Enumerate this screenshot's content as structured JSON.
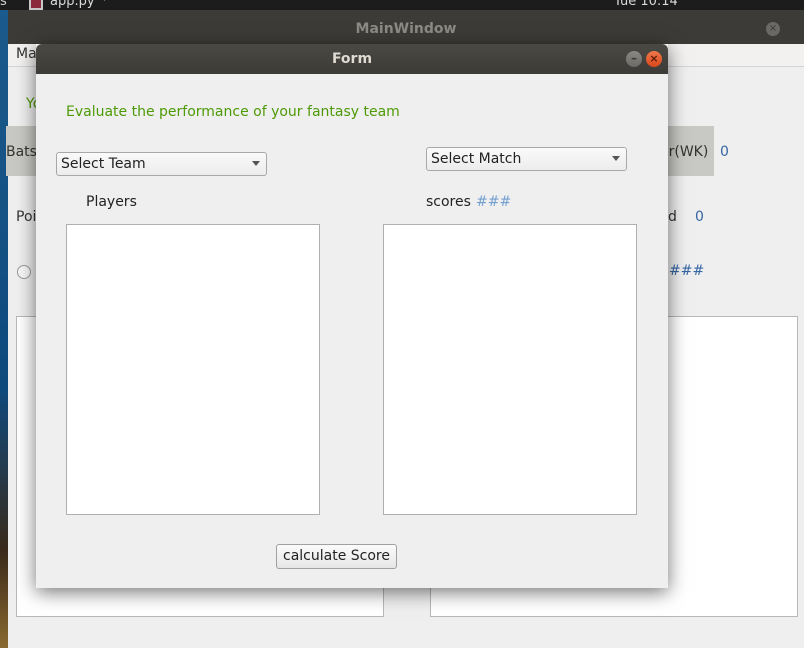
{
  "topbar": {
    "left_text": "s",
    "app_name": "app.py",
    "app_caret": "▾",
    "clock": "Tue 10:14"
  },
  "main_window": {
    "title": "MainWindow",
    "close_glyph": "×",
    "menu_label": "Ma",
    "fragment_yo": "Yo",
    "fragment_bats": "Bats",
    "fragment_wk": "er(WK)",
    "fragment_wk_value": "0",
    "fragment_poi": "Poi",
    "fragment_d": "d",
    "fragment_d_value": "0",
    "fragment_hash": "###"
  },
  "dialog": {
    "title": "Form",
    "minimize_glyph": "–",
    "close_glyph": "×",
    "heading": "Evaluate the performance of your fantasy team",
    "team_combo": "Select Team",
    "match_combo": "Select Match",
    "players_label": "Players",
    "scores_label": "scores",
    "scores_value": "###",
    "calculate_button": "calculate Score"
  },
  "colors": {
    "heading_green": "#4e9a06",
    "value_blue": "#729fcf",
    "titlebar": "#3c3b37",
    "close_orange": "#e0531f"
  }
}
